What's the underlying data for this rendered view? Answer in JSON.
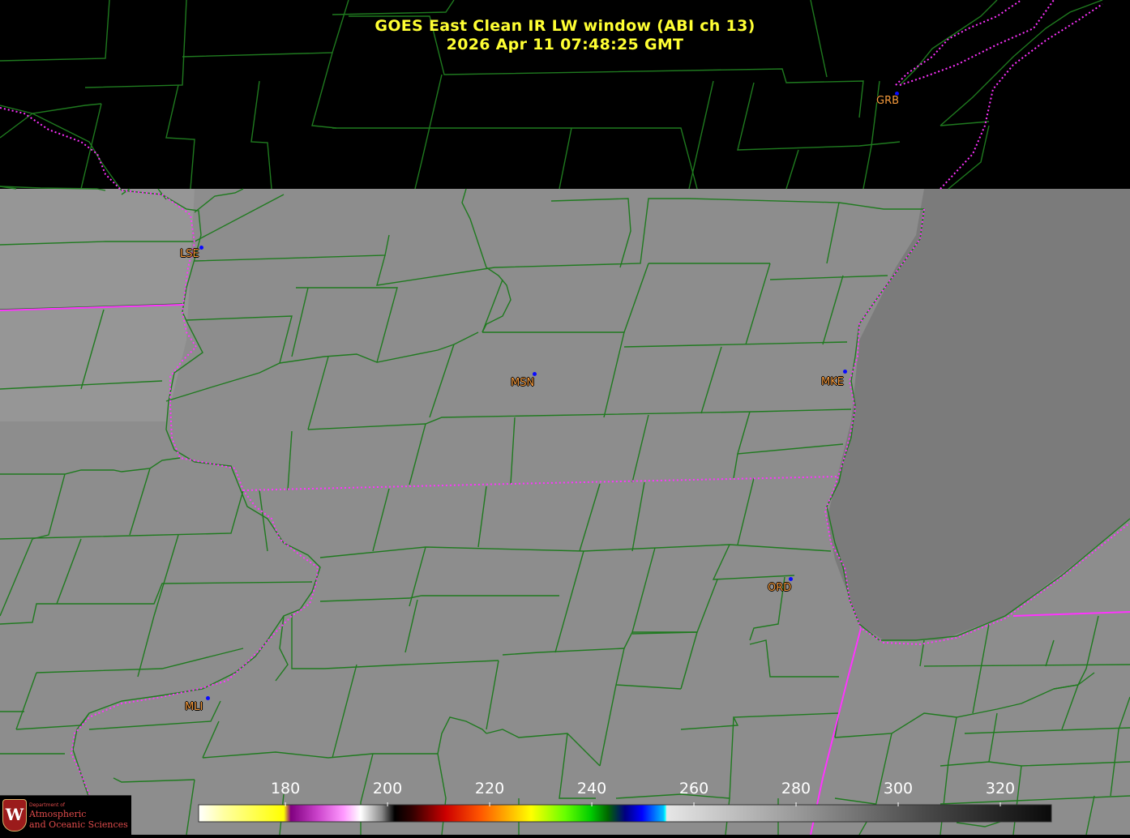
{
  "title": {
    "line1": "GOES East Clean IR LW window (ABI ch 13)",
    "line2": "2026 Apr 11  07:48:25 GMT"
  },
  "cities": [
    {
      "code": "GRB"
    },
    {
      "code": "LSE"
    },
    {
      "code": "MSN"
    },
    {
      "code": "MKE"
    },
    {
      "code": "ORD"
    },
    {
      "code": "MLI"
    }
  ],
  "colorbar": {
    "ticks": [
      "180",
      "200",
      "220",
      "240",
      "260",
      "280",
      "300",
      "320"
    ],
    "tick_values": [
      180,
      200,
      220,
      240,
      260,
      280,
      300,
      320
    ],
    "range": [
      163,
      330
    ]
  },
  "logo": {
    "dept": "Department of",
    "line1": "Atmospheric",
    "line2": "and Oceanic Sciences",
    "seal_letter": "W"
  },
  "colors": {
    "county_lines": "#1f7a1f",
    "state_lines": "#ff33ff",
    "title": "#ffff33",
    "city_label": "#f59a3c",
    "city_dot": "#0a0aff",
    "land": "#8c8c8c",
    "lake": "#7a7a7a",
    "no_data": "#000000"
  }
}
